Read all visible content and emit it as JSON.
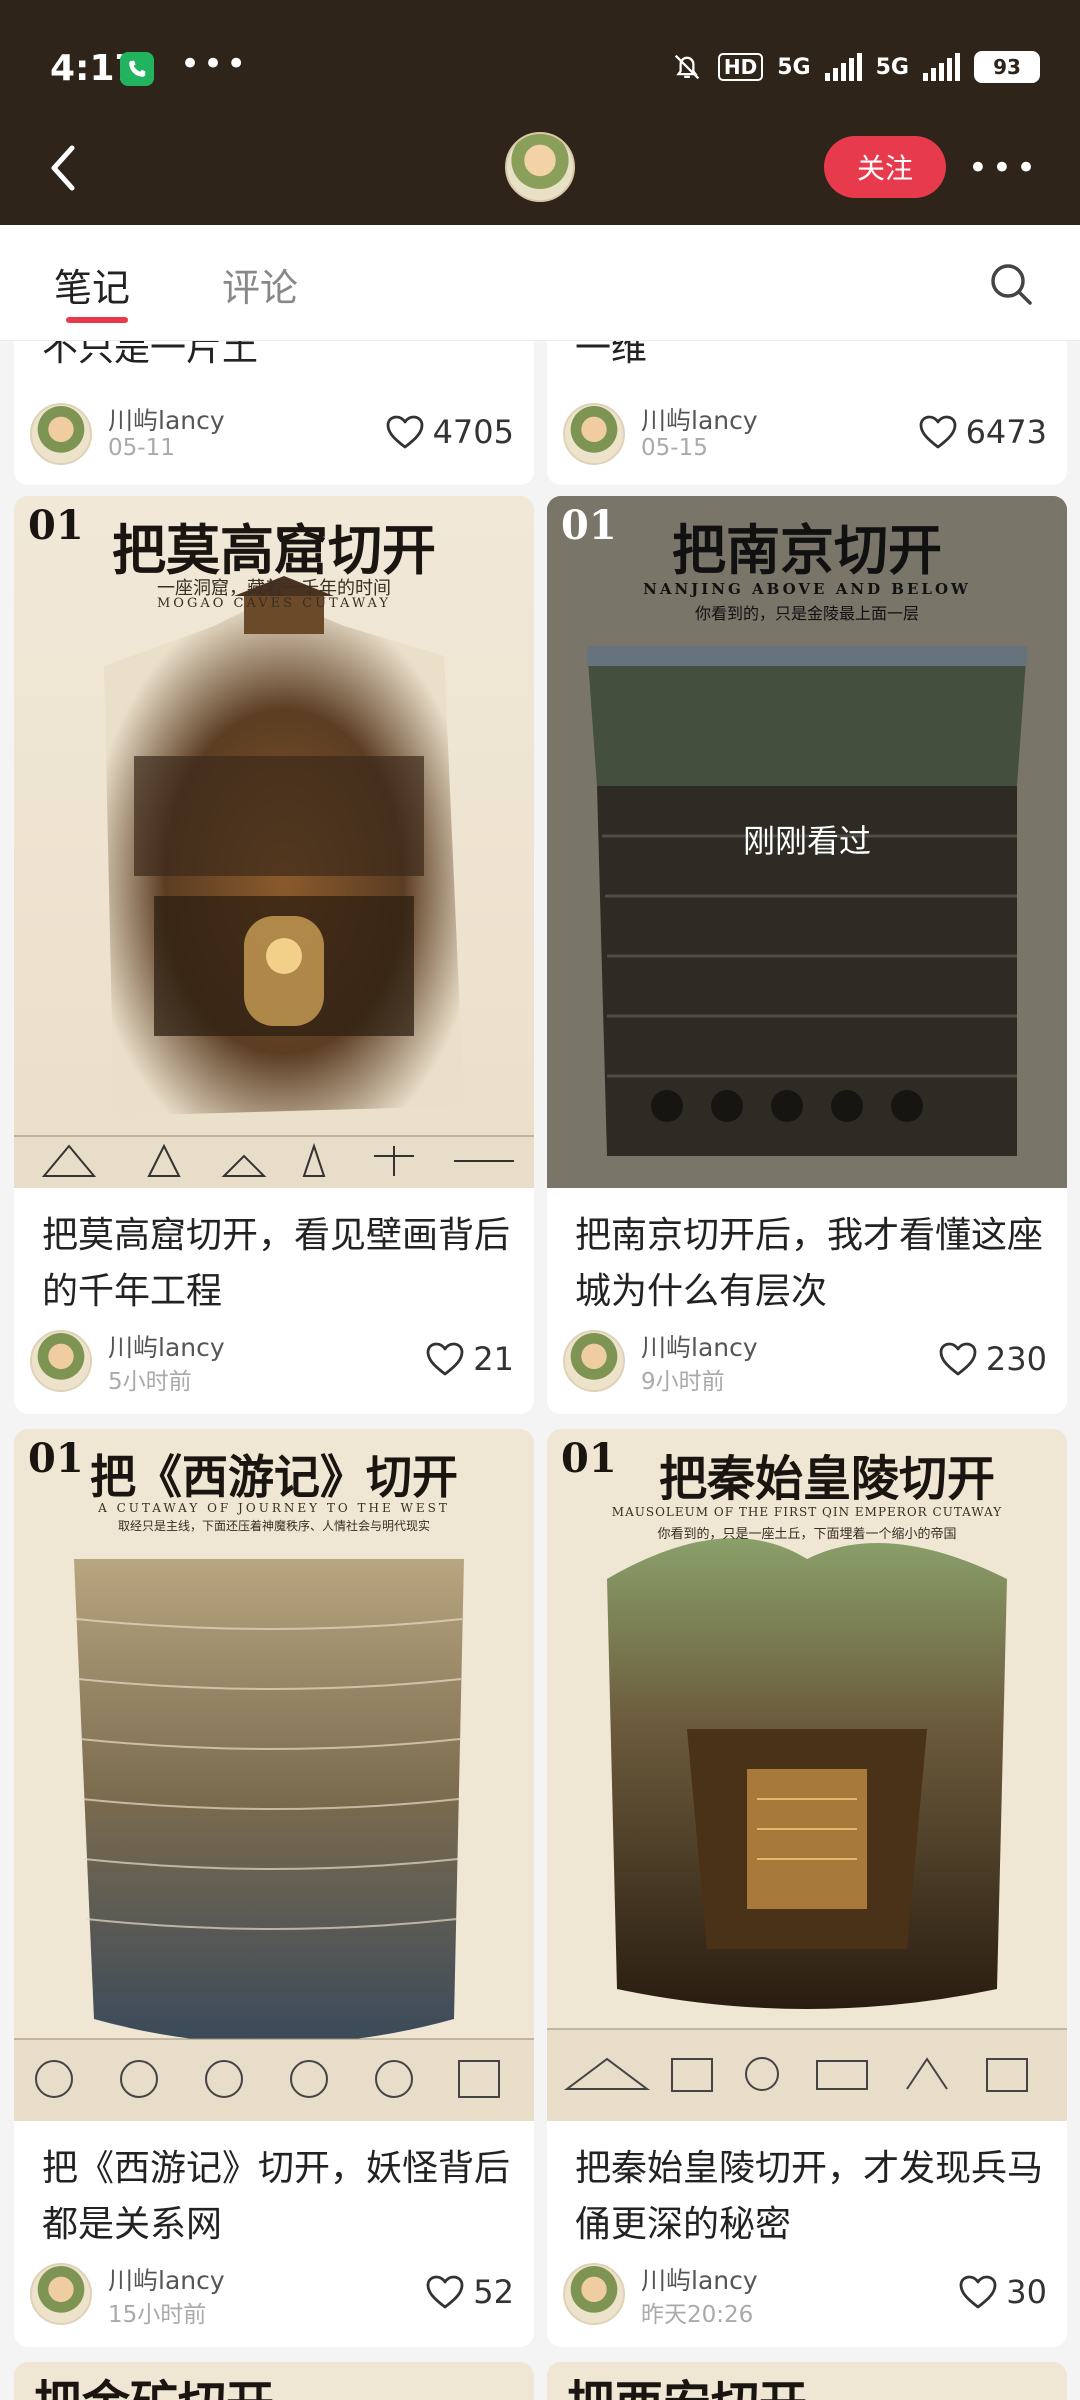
{
  "status_bar": {
    "time": "4:17",
    "network1": "5G",
    "network2": "5G",
    "hd": "HD",
    "battery": "93"
  },
  "header": {
    "follow_label": "关注"
  },
  "tabs": [
    {
      "label": "笔记",
      "active": true
    },
    {
      "label": "评论",
      "active": false
    }
  ],
  "top_cards": [
    {
      "title_tail": "不只是一片土",
      "author": "川屿lancy",
      "date": "05-11",
      "likes": "4705"
    },
    {
      "title_tail": "一维",
      "author": "川屿lancy",
      "date": "05-15",
      "likes": "6473"
    }
  ],
  "cards": [
    {
      "poster_num": "01",
      "poster_title": "把莫高窟切开",
      "poster_sub": "一座洞窟，藏着一千年的时间",
      "poster_sub2": "MOGAO CAVES CUTAWAY",
      "title": "把莫高窟切开，看见壁画背后的千年工程",
      "author": "川屿lancy",
      "date": "5小时前",
      "likes": "21"
    },
    {
      "poster_num": "01",
      "poster_title": "把南京切开",
      "poster_sub": "你看到的，只是金陵最上面一层",
      "poster_sub2": "NANJING ABOVE AND BELOW",
      "overlay": "刚刚看过",
      "title": "把南京切开后，我才看懂这座城为什么有层次",
      "author": "川屿lancy",
      "date": "9小时前",
      "likes": "230"
    },
    {
      "poster_num": "01",
      "poster_title": "把《西游记》切开",
      "poster_sub": "取经只是主线，下面还压着神魔秩序、人情社会与明代现实",
      "poster_sub2": "A CUTAWAY OF JOURNEY TO THE WEST",
      "title": "把《西游记》切开，妖怪背后都是关系网",
      "author": "川屿lancy",
      "date": "15小时前",
      "likes": "52"
    },
    {
      "poster_num": "01",
      "poster_title": "把秦始皇陵切开",
      "poster_sub": "你看到的，只是一座土丘，下面埋着一个缩小的帝国",
      "poster_sub2": "MAUSOLEUM OF THE FIRST QIN EMPEROR CUTAWAY",
      "title": "把秦始皇陵切开，才发现兵马俑更深的秘密",
      "author": "川屿lancy",
      "date": "昨天20:26",
      "likes": "30"
    }
  ],
  "bottom_peek": [
    {
      "title": "把金矿切开"
    },
    {
      "title": "把西安切开"
    }
  ],
  "colors": {
    "header_bg": "#2f2419",
    "accent": "#e83a4d",
    "page_bg": "#f4f4f4"
  }
}
